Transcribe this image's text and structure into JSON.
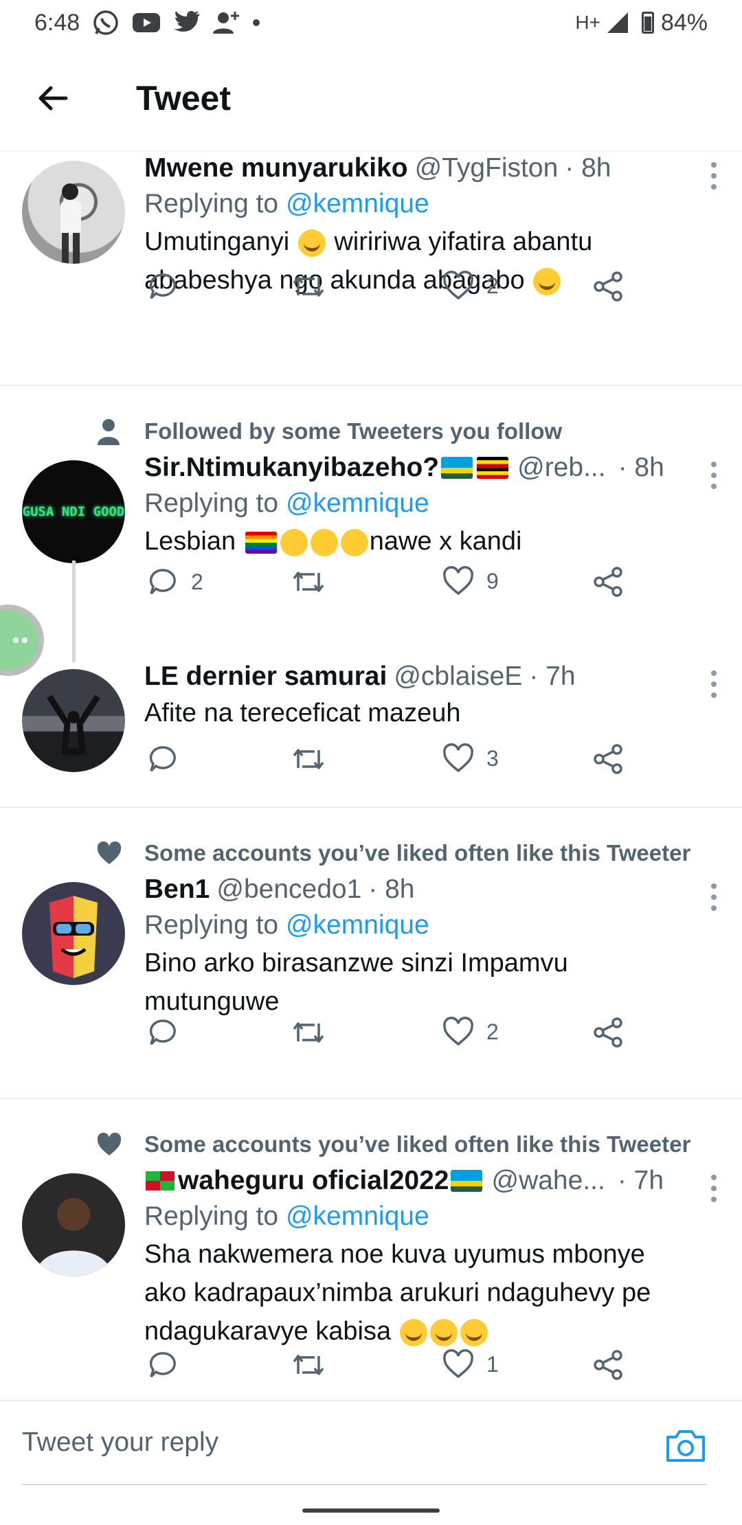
{
  "status_bar": {
    "time": "6:48",
    "network": "H+",
    "battery": "84%"
  },
  "header": {
    "title": "Tweet"
  },
  "tweets": [
    {
      "name": "Mwene munyarukiko",
      "handle": "@TygFiston",
      "time": "· 8h",
      "replying_prefix": "Replying to ",
      "replying_to": "@kemnique",
      "text_1": "Umutinganyi",
      "text_2": "wiririwa yifatira abantu",
      "text_3": "ababeshya ngo akunda abagabo",
      "replies": "",
      "retweets": "",
      "likes": "2"
    },
    {
      "social": "Followed by some Tweeters you follow",
      "name": "Sir.Ntimukanyibazeho?",
      "handle": "@reb...",
      "time": "· 8h",
      "replying_prefix": "Replying to ",
      "replying_to": "@kemnique",
      "text_1": "Lesbian",
      "text_2": "nawe x kandi",
      "replies": "2",
      "retweets": "",
      "likes": "9",
      "avatar_text": "GUSA NDI GOOD"
    },
    {
      "name": "LE dernier samurai",
      "handle": "@cblaiseE",
      "time": "· 7h",
      "text_1": "Afite na tereceficat mazeuh",
      "replies": "",
      "retweets": "",
      "likes": "3"
    },
    {
      "social": "Some accounts you’ve liked often like this Tweeter",
      "name": "Ben1",
      "handle": "@bencedo1",
      "time": "· 8h",
      "replying_prefix": "Replying to ",
      "replying_to": "@kemnique",
      "text_1": "Bino arko birasanzwe sinzi Impamvu",
      "text_2": "mutunguwe",
      "replies": "",
      "retweets": "",
      "likes": "2"
    },
    {
      "social": "Some accounts you’ve liked often like this Tweeter",
      "name": "waheguru oficial2022",
      "handle": "@wahe...",
      "time": "· 7h",
      "replying_prefix": "Replying to ",
      "replying_to": "@kemnique",
      "text_1": "Sha nakwemera noe kuva uyumus mbonye",
      "text_2": "ako kadrapaux’nimba arukuri ndaguhevy pe",
      "text_3": "ndagukaravye kabisa",
      "likes": "1"
    }
  ],
  "reply_bar": {
    "placeholder": "Tweet your reply"
  },
  "icons": {
    "back": "arrow-left-icon",
    "reply": "reply-bubble-icon",
    "retweet": "retweet-icon",
    "like": "heart-icon",
    "share": "share-icon",
    "more": "more-vertical-icon",
    "camera": "camera-icon",
    "person": "person-icon"
  },
  "colors": {
    "accent": "#1d9bf0",
    "secondary_text": "#536471"
  }
}
